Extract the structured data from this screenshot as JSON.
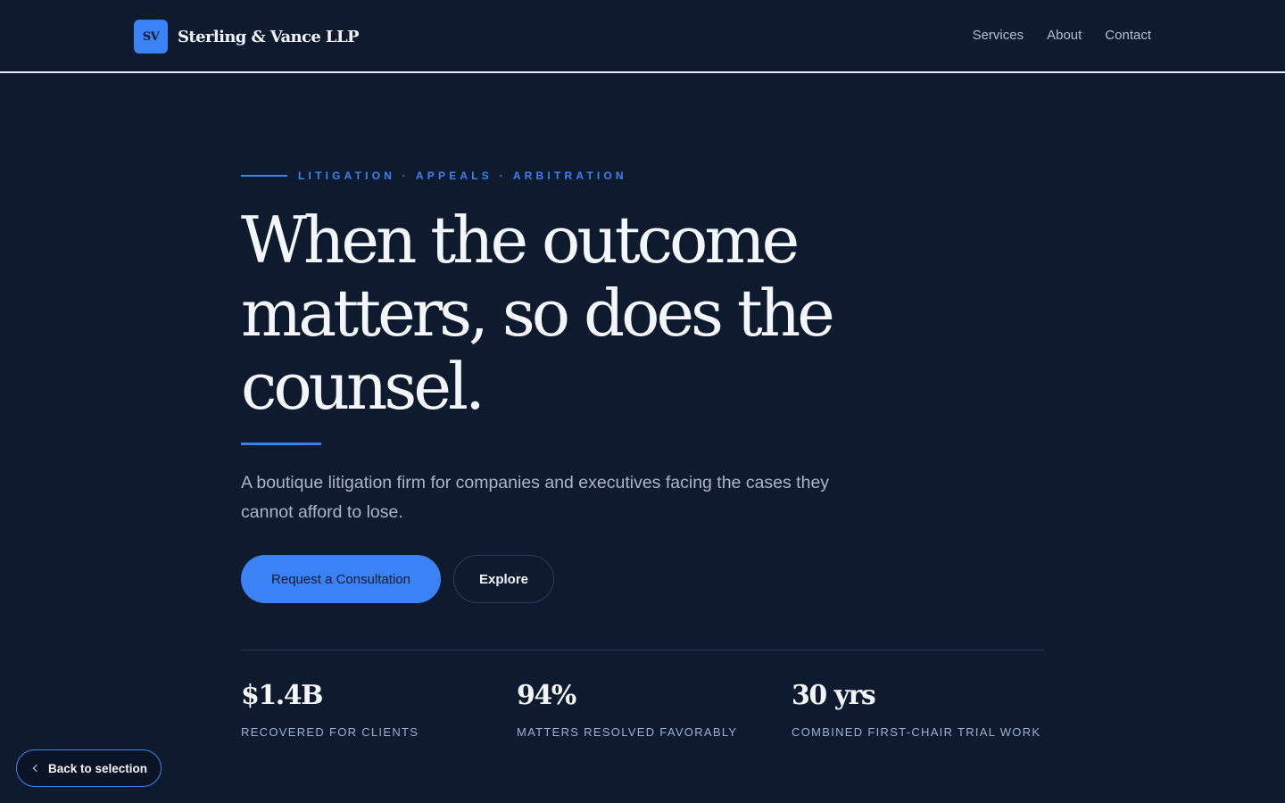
{
  "header": {
    "logo_mark": "SV",
    "firm_name": "Sterling & Vance LLP",
    "nav": [
      "Services",
      "About",
      "Contact"
    ]
  },
  "hero": {
    "eyebrow": "LITIGATION · APPEALS · ARBITRATION",
    "headline": "When the outcome matters, so does the counsel.",
    "subtitle": "A boutique litigation firm for companies and executives facing the cases they cannot afford to lose.",
    "primary_cta": "Request a Consultation",
    "secondary_cta": "Explore"
  },
  "stats": [
    {
      "value": "$1.4B",
      "label": "RECOVERED FOR CLIENTS"
    },
    {
      "value": "94%",
      "label": "MATTERS RESOLVED FAVORABLY"
    },
    {
      "value": "30 yrs",
      "label": "COMBINED FIRST-CHAIR TRIAL WORK"
    }
  ],
  "back_button": "Back to selection",
  "colors": {
    "background": "#0e1b2e",
    "accent": "#3b82f6",
    "text_primary": "#f3f6fb",
    "text_muted": "#a9b6c8"
  },
  "icons": {
    "back": "chevron-left-icon"
  }
}
